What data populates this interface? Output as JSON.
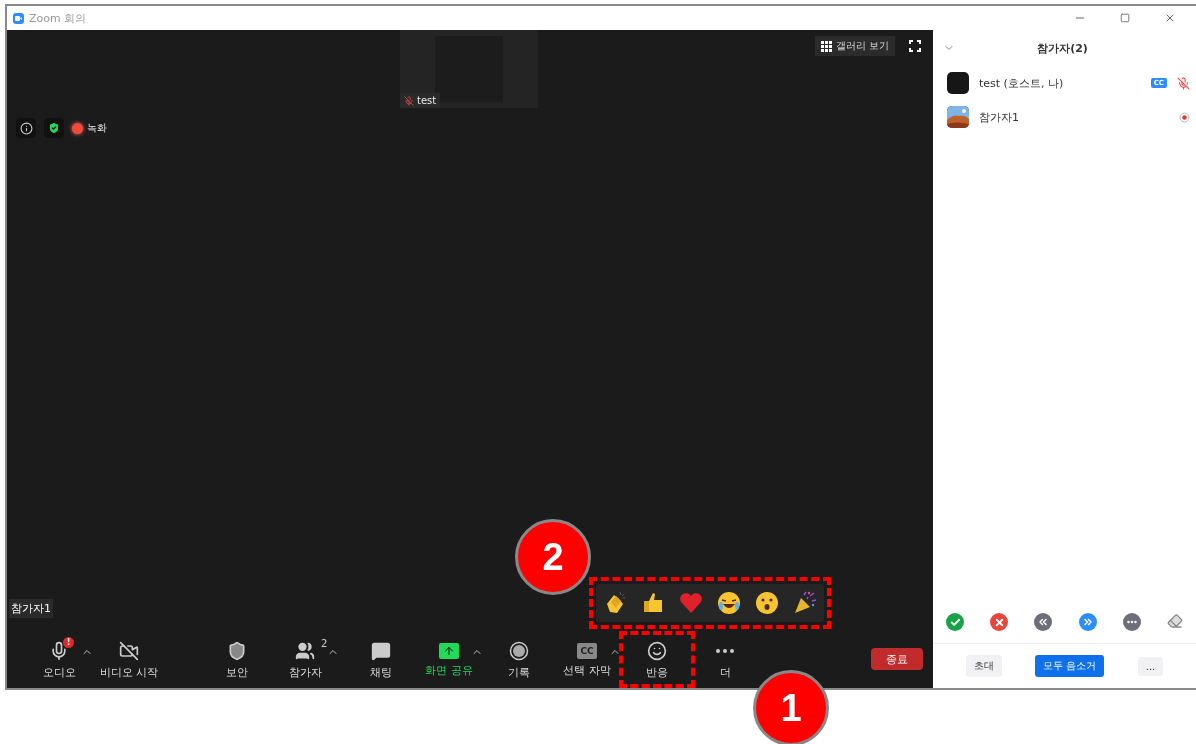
{
  "window": {
    "title": "Zoom 회의"
  },
  "video": {
    "thumbnail": {
      "name": "test",
      "muted": true
    },
    "gallery_button": "갤러리 보기",
    "recording_label": "녹화",
    "speaker_label": "참가자1",
    "reactions_popup": {
      "highlighted": true,
      "items": [
        {
          "kind": "clap"
        },
        {
          "kind": "thumbs"
        },
        {
          "kind": "heart"
        },
        {
          "kind": "laugh"
        },
        {
          "kind": "wow"
        },
        {
          "kind": "party"
        }
      ]
    }
  },
  "toolbar": {
    "items": [
      {
        "kind": "audio",
        "label": "오디오",
        "alert": "!",
        "caret": true,
        "highlighted": false
      },
      {
        "kind": "video",
        "label": "비디오 시작",
        "caret": false,
        "highlighted": false
      },
      {
        "kind": "security",
        "label": "보안",
        "caret": false,
        "highlighted": false
      },
      {
        "kind": "participants",
        "label": "참가자",
        "count": "2",
        "caret": true,
        "highlighted": false
      },
      {
        "kind": "chat",
        "label": "채팅",
        "caret": false,
        "highlighted": false
      },
      {
        "kind": "share",
        "label": "화면 공유",
        "caret": true,
        "highlighted": false
      },
      {
        "kind": "record",
        "label": "기록",
        "caret": false,
        "highlighted": false
      },
      {
        "kind": "captions",
        "label": "선택 자막",
        "icon_text": "CC",
        "caret": true,
        "highlighted": false
      },
      {
        "kind": "reactions",
        "label": "반응",
        "caret": false,
        "highlighted": true
      },
      {
        "kind": "more",
        "label": "더",
        "caret": false,
        "highlighted": false
      }
    ],
    "end_button": "종료"
  },
  "panel": {
    "title": "참가자(2)",
    "participants": [
      {
        "name": "test (호스트, 나)",
        "avatar": {
          "kind": "dark"
        },
        "badge": "CC",
        "status_icon": {
          "kind": "muted"
        }
      },
      {
        "name": "참가자1",
        "status_icon": {
          "kind": "recording"
        }
      }
    ],
    "feedback": [
      {
        "kind": "yes"
      },
      {
        "kind": "no"
      },
      {
        "kind": "slower"
      },
      {
        "kind": "faster"
      },
      {
        "kind": "more"
      },
      {
        "kind": "clear"
      }
    ],
    "buttons": [
      {
        "label": "초대",
        "kind": "plain"
      },
      {
        "label": "모두 음소거",
        "kind": "primary"
      },
      {
        "label": "...",
        "kind": "plain"
      }
    ]
  },
  "callouts": [
    {
      "number": "2"
    },
    {
      "number": "1"
    }
  ]
}
